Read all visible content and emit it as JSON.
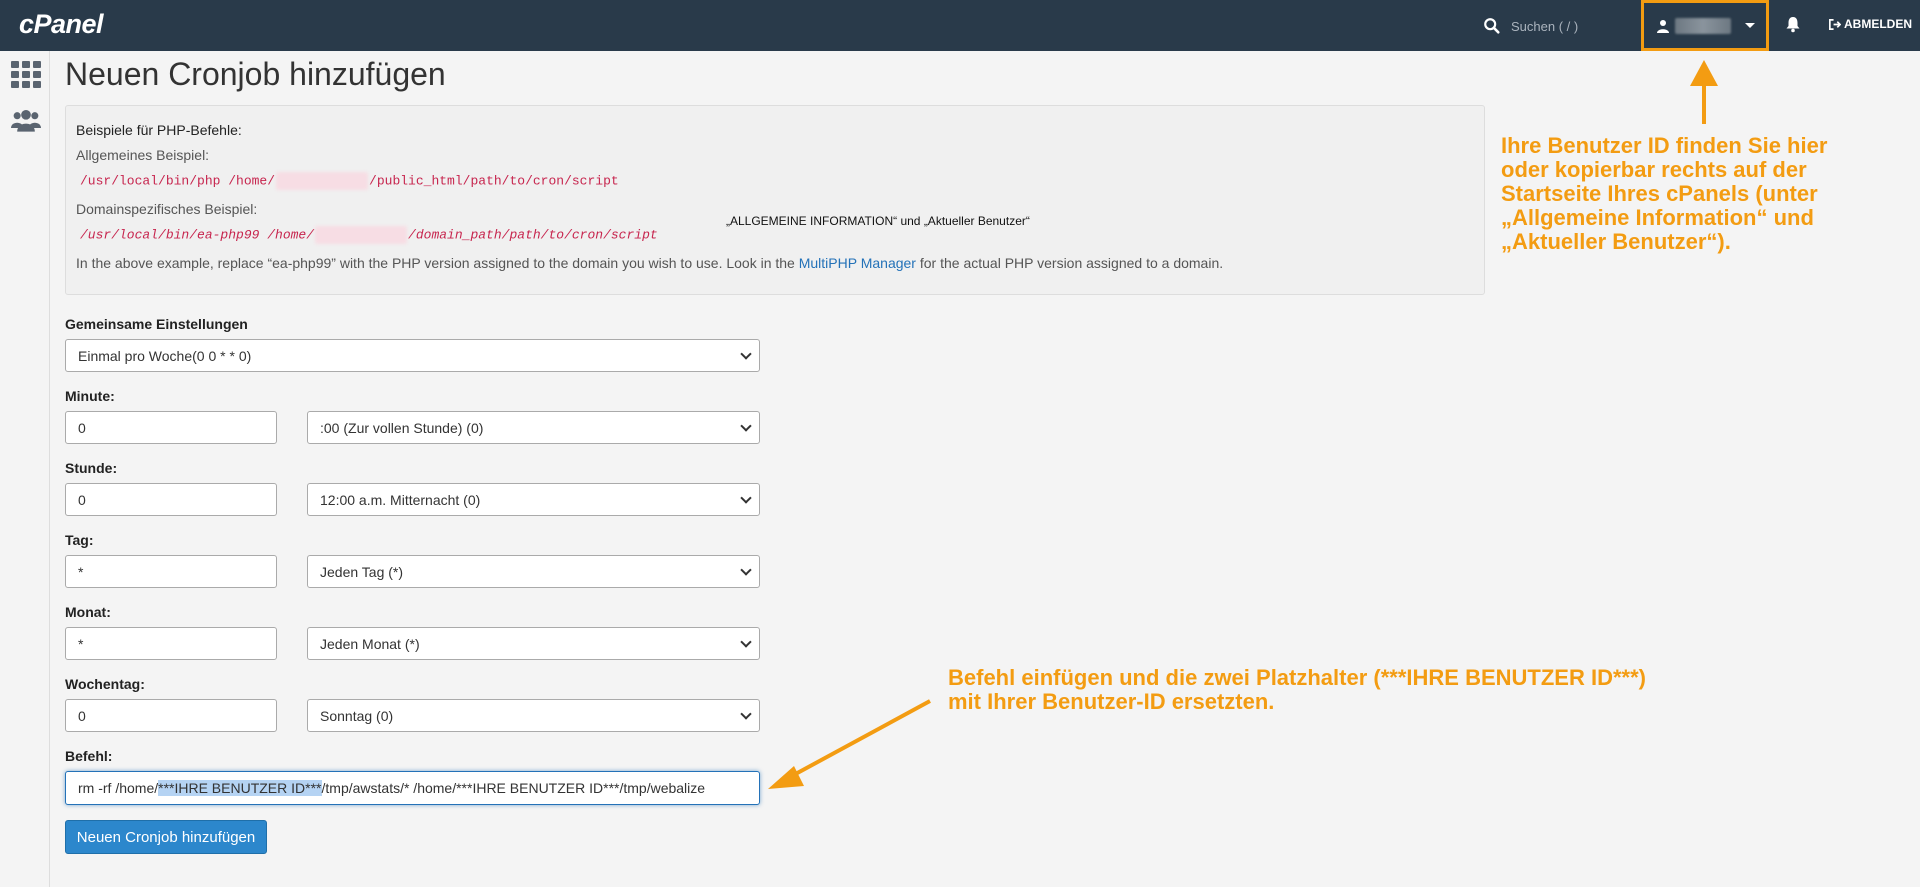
{
  "header": {
    "logo": "cPanel",
    "search_placeholder": "Suchen ( / )",
    "logout_label": "ABMELDEN"
  },
  "page": {
    "title": "Neuen Cronjob hinzufügen"
  },
  "info_box": {
    "heading": "Beispiele für PHP-Befehle:",
    "general_label": "Allgemeines Beispiel:",
    "general_code_prefix": "/usr/local/bin/php /home/",
    "general_code_suffix": "/public_html/path/to/cron/script",
    "domain_label": "Domainspezifisches Beispiel:",
    "domain_code_prefix": "/usr/local/bin/ea-php99 /home/",
    "domain_code_suffix": "/domain_path/path/to/cron/script",
    "note_before": "In the above example, replace “ea-php99” with the PHP version assigned to the domain you wish to use. Look in the ",
    "note_link": "MultiPHP Manager",
    "note_after": " for the actual PHP version assigned to a domain."
  },
  "form": {
    "common_label": "Gemeinsame Einstellungen",
    "common_value": "Einmal pro Woche(0 0 * * 0)",
    "minute_label": "Minute:",
    "minute_value": "0",
    "minute_select": ":00 (Zur vollen Stunde) (0)",
    "hour_label": "Stunde:",
    "hour_value": "0",
    "hour_select": "12:00 a.m. Mitternacht (0)",
    "day_label": "Tag:",
    "day_value": "*",
    "day_select": "Jeden Tag (*)",
    "month_label": "Monat:",
    "month_value": "*",
    "month_select": "Jeden Monat (*)",
    "weekday_label": "Wochentag:",
    "weekday_value": "0",
    "weekday_select": "Sonntag (0)",
    "command_label": "Befehl:",
    "command_before": "rm -rf /home/",
    "command_highlight": "***IHRE BENUTZER ID***",
    "command_after": "/tmp/awstats/* /home/***IHRE BENUTZER ID***/tmp/webalize",
    "submit_label": "Neuen Cronjob hinzufügen"
  },
  "annotations": {
    "mid_note": "„ALLGEMEINE INFORMATION“ und „Aktueller Benutzer“",
    "top_note_lines": [
      "Ihre Benutzer ID finden Sie hier",
      "oder kopierbar rechts auf der",
      "Startseite Ihres cPanels (unter",
      "„Allgemeine Information“ und",
      "„Aktueller Benutzer“)."
    ],
    "bottom_note_lines": [
      "Befehl einfügen und die zwei Platzhalter (***IHRE BENUTZER ID***)",
      "mit Ihrer Benutzer-ID ersetzten."
    ],
    "accent_color": "#f39c12"
  }
}
